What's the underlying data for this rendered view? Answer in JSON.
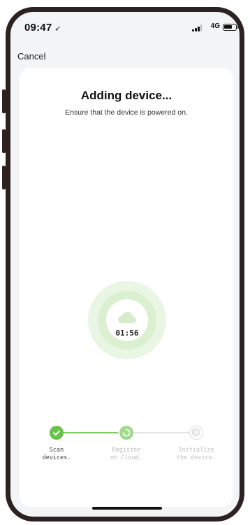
{
  "status_bar": {
    "time": "09:47",
    "network": "4G"
  },
  "nav": {
    "cancel_label": "Cancel"
  },
  "main": {
    "title": "Adding device...",
    "subtitle": "Ensure that the device is powered on.",
    "timer": "01:56"
  },
  "steps": [
    {
      "line1": "Scan",
      "line2": "devices.",
      "state": "done"
    },
    {
      "line1": "Register",
      "line2": "on Cloud.",
      "state": "in-progress"
    },
    {
      "line1": "Initialize",
      "line2": "the device.",
      "state": "pending"
    }
  ],
  "colors": {
    "accent_green": "#69c24a",
    "ring_light": "#eaf6e4",
    "pending_gray": "#dcdcdc"
  },
  "icons": [
    "location-arrow-icon",
    "signal-icon",
    "battery-icon",
    "cloud-icon",
    "check-icon",
    "spinner-icon",
    "c-icon"
  ]
}
